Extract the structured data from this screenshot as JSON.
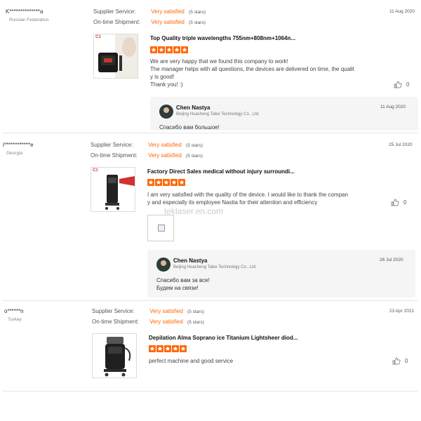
{
  "labels": {
    "supplier_service": "Supplier Service:",
    "ontime_shipment": "On-time Shipment:"
  },
  "colors": {
    "accent": "#ff6600",
    "reply_bg": "#f5f5f5",
    "divider": "#e5e5e5"
  },
  "reviews": [
    {
      "buyer": "K**************a",
      "country": "Russian Federation",
      "supplier_value": "Very satisfied",
      "supplier_stars": "(5 stars)",
      "shipment_value": "Very satisfied",
      "shipment_stars": "(5 stars)",
      "date": "11 Aug 2020",
      "badge": "C1",
      "product_title": "Top Quality triple wavelengths 755nm+808nm+1064n...",
      "rating": 5,
      "text_lines": [
        "We are very happy that we found this company to work!",
        "The manager helps with all questions, the devices are delivered on time, the qualit",
        "y is good!",
        "Thank you! :)"
      ],
      "likes": "0",
      "reply": {
        "name": "Chen Nastya",
        "company": "Beijing Huacheng Taike Technology Co., Ltd.",
        "date": "11 Aug 2020",
        "lines": [
          "Спасибо вам большое!"
        ]
      }
    },
    {
      "buyer": "i************e",
      "country": "Georgia",
      "supplier_value": "Very satisfied",
      "supplier_stars": "(5 stars)",
      "shipment_value": "Very satisfied",
      "shipment_stars": "(5 stars)",
      "date": "25 Jul 2020",
      "badge": "C1",
      "product_title": "Factory Direct Sales medical without injury surroundi...",
      "rating": 5,
      "text_lines": [
        "I am very satisfied with the quality of the device. I would like to thank the compan",
        "y and especially its employee Nastia for their attention and efficiency"
      ],
      "watermark": "teklaser.en.com",
      "likes": "0",
      "reply": {
        "name": "Chen Nastya",
        "company": "Beijing Huacheng Taike Technology Co., Ltd.",
        "date": "26 Jul 2020",
        "lines": [
          "Спасибо вам за все!",
          "Будем на связи!"
        ]
      }
    },
    {
      "buyer": "o******n",
      "country": "Turkey",
      "supplier_value": "Very satisfied",
      "supplier_stars": "(5 stars)",
      "shipment_value": "Very satisfied",
      "shipment_stars": "(5 stars)",
      "date": "23 Apr 2021",
      "product_title": "Depilation Alma Soprano ice Titanium Lightsheer diod...",
      "rating": 5,
      "text_lines": [
        "perfect machine and good service"
      ],
      "likes": "0"
    }
  ]
}
